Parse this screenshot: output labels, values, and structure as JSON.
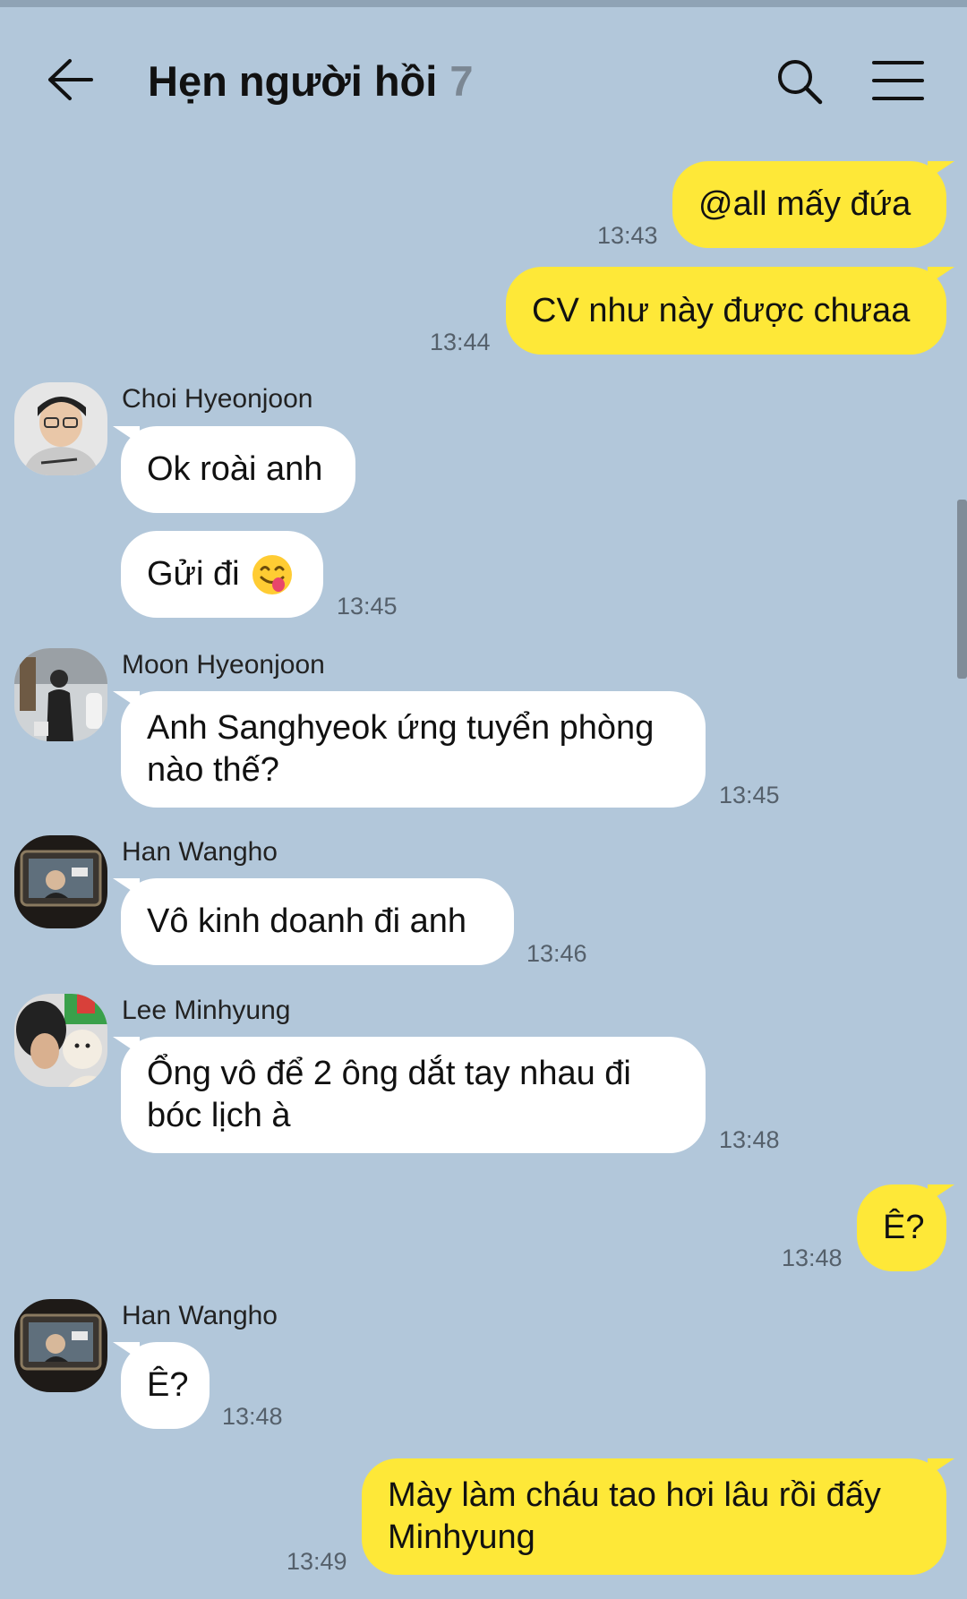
{
  "header": {
    "title": "Hẹn người hồi",
    "member_count": "7"
  },
  "messages": [
    {
      "side": "me",
      "text": "@all mấy đứa",
      "time": "13:43"
    },
    {
      "side": "me",
      "text": "CV như này được chưaa",
      "time": "13:44"
    },
    {
      "side": "them",
      "sender": "Choi Hyeonjoon",
      "text": "Ok roài anh"
    },
    {
      "side": "them",
      "text": "Gửi đi",
      "emoji": "yum-face-emoji",
      "time": "13:45"
    },
    {
      "side": "them",
      "sender": "Moon Hyeonjoon",
      "text": "Anh Sanghyeok ứng tuyển phòng nào thế?",
      "time": "13:45"
    },
    {
      "side": "them",
      "sender": "Han Wangho",
      "text": "Vô kinh doanh đi anh",
      "time": "13:46"
    },
    {
      "side": "them",
      "sender": "Lee Minhyung",
      "text": "Ổng vô để 2 ông dắt tay nhau đi bóc lịch à",
      "time": "13:48"
    },
    {
      "side": "me",
      "text": "Ê?",
      "time": "13:48"
    },
    {
      "side": "them",
      "sender": "Han Wangho",
      "text": "Ê?",
      "time": "13:48"
    },
    {
      "side": "me",
      "text": "Mày làm cháu tao hơi lâu rồi đấy Minhyung",
      "time": "13:49"
    }
  ],
  "icons": {
    "back": "arrow-left-icon",
    "search": "search-icon",
    "menu": "hamburger-menu-icon"
  },
  "colors": {
    "background": "#b2c7da",
    "my_bubble": "#fee838",
    "their_bubble": "#ffffff"
  }
}
